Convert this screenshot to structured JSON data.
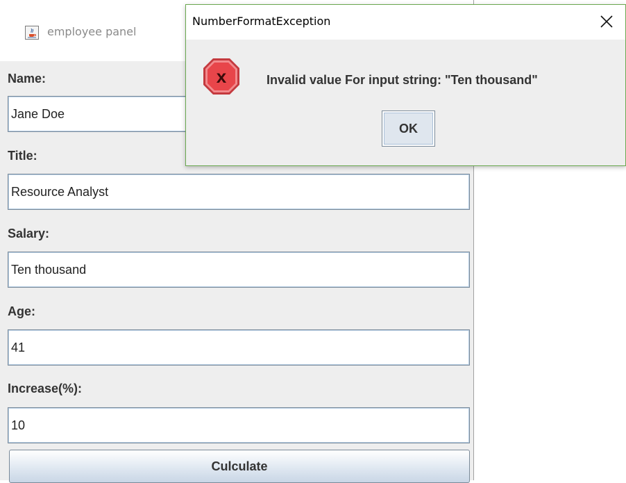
{
  "main_window": {
    "title": "employee panel",
    "icon": "java-cup-icon",
    "fields": [
      {
        "label": "Name:",
        "value": "Jane Doe"
      },
      {
        "label": "Title:",
        "value": "Resource Analyst"
      },
      {
        "label": "Salary:",
        "value": "Ten thousand"
      },
      {
        "label": "Age:",
        "value": "41"
      },
      {
        "label": "Increase(%):",
        "value": "10"
      }
    ],
    "calculate_label": "Culculate"
  },
  "dialog": {
    "title": "NumberFormatException",
    "message": "Invalid value For input string: \"Ten thousand\"",
    "ok_label": "OK",
    "icon": "error-x-icon",
    "close_icon": "close-icon"
  },
  "colors": {
    "dialog_border": "#6aa84f",
    "error_icon": "#e8454a",
    "window_background": "#eeeeee"
  }
}
